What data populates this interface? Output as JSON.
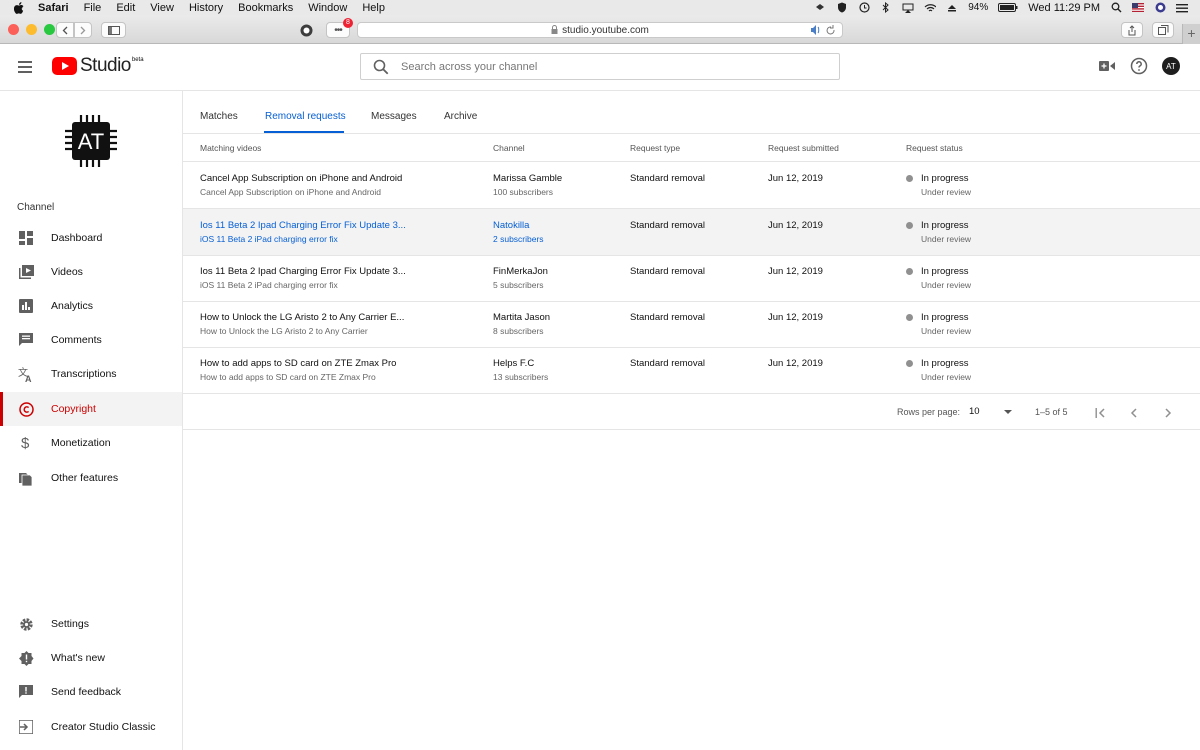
{
  "menubar": {
    "app": "Safari",
    "items": [
      "File",
      "Edit",
      "View",
      "History",
      "Bookmarks",
      "Window",
      "Help"
    ],
    "battery": "94%",
    "clock": "Wed 11:29 PM"
  },
  "browser": {
    "url": "studio.youtube.com",
    "badge": "8"
  },
  "header": {
    "logo_text": "Studio",
    "logo_badge": "beta",
    "search_placeholder": "Search across your channel",
    "avatar_initials": "AT"
  },
  "sidebar": {
    "channel_initials": "AT",
    "section_label": "Channel",
    "items": [
      {
        "label": "Dashboard"
      },
      {
        "label": "Videos"
      },
      {
        "label": "Analytics"
      },
      {
        "label": "Comments"
      },
      {
        "label": "Transcriptions"
      },
      {
        "label": "Copyright"
      },
      {
        "label": "Monetization"
      },
      {
        "label": "Other features"
      }
    ],
    "bottom_items": [
      {
        "label": "Settings"
      },
      {
        "label": "What's new"
      },
      {
        "label": "Send feedback"
      },
      {
        "label": "Creator Studio Classic"
      }
    ]
  },
  "tabs": [
    "Matches",
    "Removal requests",
    "Messages",
    "Archive"
  ],
  "table": {
    "columns": [
      "Matching videos",
      "Channel",
      "Request type",
      "Request submitted",
      "Request status"
    ],
    "rows": [
      {
        "video_title": "Cancel App Subscription on iPhone and Android",
        "video_sub": "Cancel App Subscription on iPhone and Android",
        "channel": "Marissa Gamble",
        "subscribers": "100 subscribers",
        "type": "Standard removal",
        "submitted": "Jun 12, 2019",
        "status": "In progress",
        "status_sub": "Under review"
      },
      {
        "video_title": "Ios 11 Beta 2 Ipad Charging Error Fix Update 3...",
        "video_sub": "iOS 11 Beta 2 iPad charging error fix",
        "channel": "Natokilla",
        "subscribers": "2 subscribers",
        "type": "Standard removal",
        "submitted": "Jun 12, 2019",
        "status": "In progress",
        "status_sub": "Under review"
      },
      {
        "video_title": "Ios 11 Beta 2 Ipad Charging Error Fix Update 3...",
        "video_sub": "iOS 11 Beta 2 iPad charging error fix",
        "channel": "FinMerkaJon",
        "subscribers": "5 subscribers",
        "type": "Standard removal",
        "submitted": "Jun 12, 2019",
        "status": "In progress",
        "status_sub": "Under review"
      },
      {
        "video_title": "How to Unlock the LG Aristo 2 to Any Carrier E...",
        "video_sub": "How to Unlock the LG Aristo 2 to Any Carrier",
        "channel": "Martita Jason",
        "subscribers": "8 subscribers",
        "type": "Standard removal",
        "submitted": "Jun 12, 2019",
        "status": "In progress",
        "status_sub": "Under review"
      },
      {
        "video_title": "How to add apps to SD card on ZTE Zmax Pro",
        "video_sub": "How to add apps to SD card on ZTE Zmax Pro",
        "channel": "Helps F.C",
        "subscribers": "13 subscribers",
        "type": "Standard removal",
        "submitted": "Jun 12, 2019",
        "status": "In progress",
        "status_sub": "Under review"
      }
    ]
  },
  "pagination": {
    "rows_label": "Rows per page:",
    "rows_value": "10",
    "range": "1–5 of 5"
  },
  "colors": {
    "accent_blue": "#065fd4",
    "youtube_red": "#ff0000",
    "active_red": "#cc0000"
  }
}
